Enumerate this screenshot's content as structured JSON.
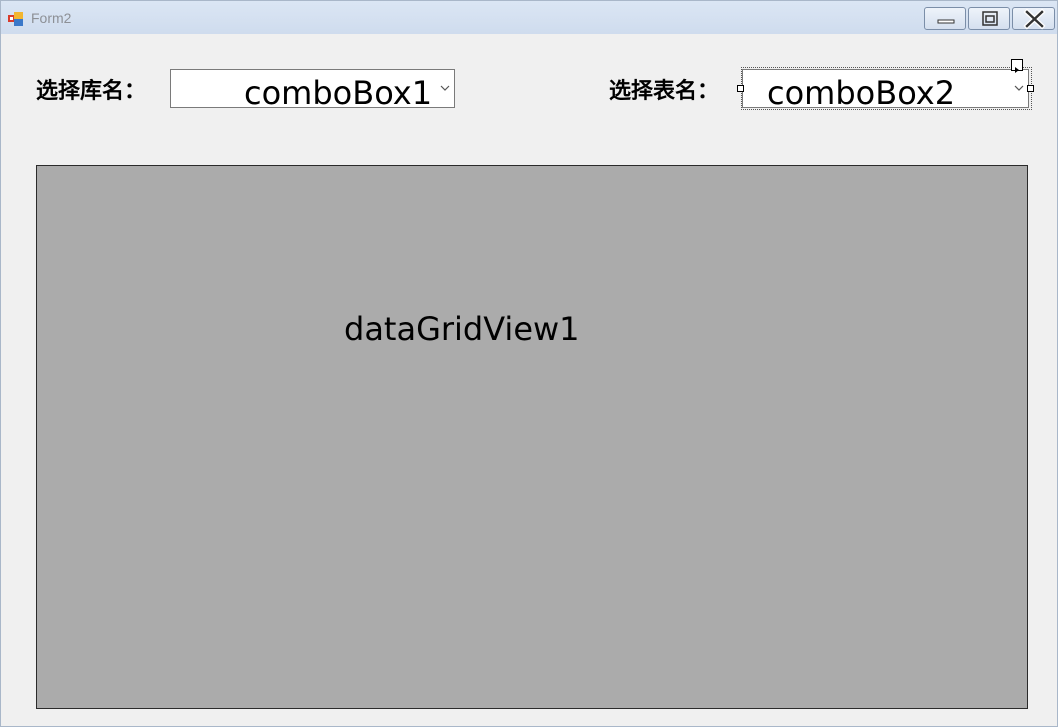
{
  "window": {
    "title": "Form2"
  },
  "form": {
    "database_label": "选择库名：",
    "table_label": "选择表名：",
    "combo1": {
      "text": "comboBox1"
    },
    "combo2": {
      "text": "comboBox2"
    },
    "grid": {
      "text": "dataGridView1",
      "background": "#ababab"
    }
  },
  "icons": {
    "app": "form-icon",
    "minimize": "minimize-icon",
    "maximize": "maximize-icon",
    "close": "close-icon",
    "dropdown": "chevron-down-icon",
    "smart_tag": "triangle-right-icon"
  }
}
